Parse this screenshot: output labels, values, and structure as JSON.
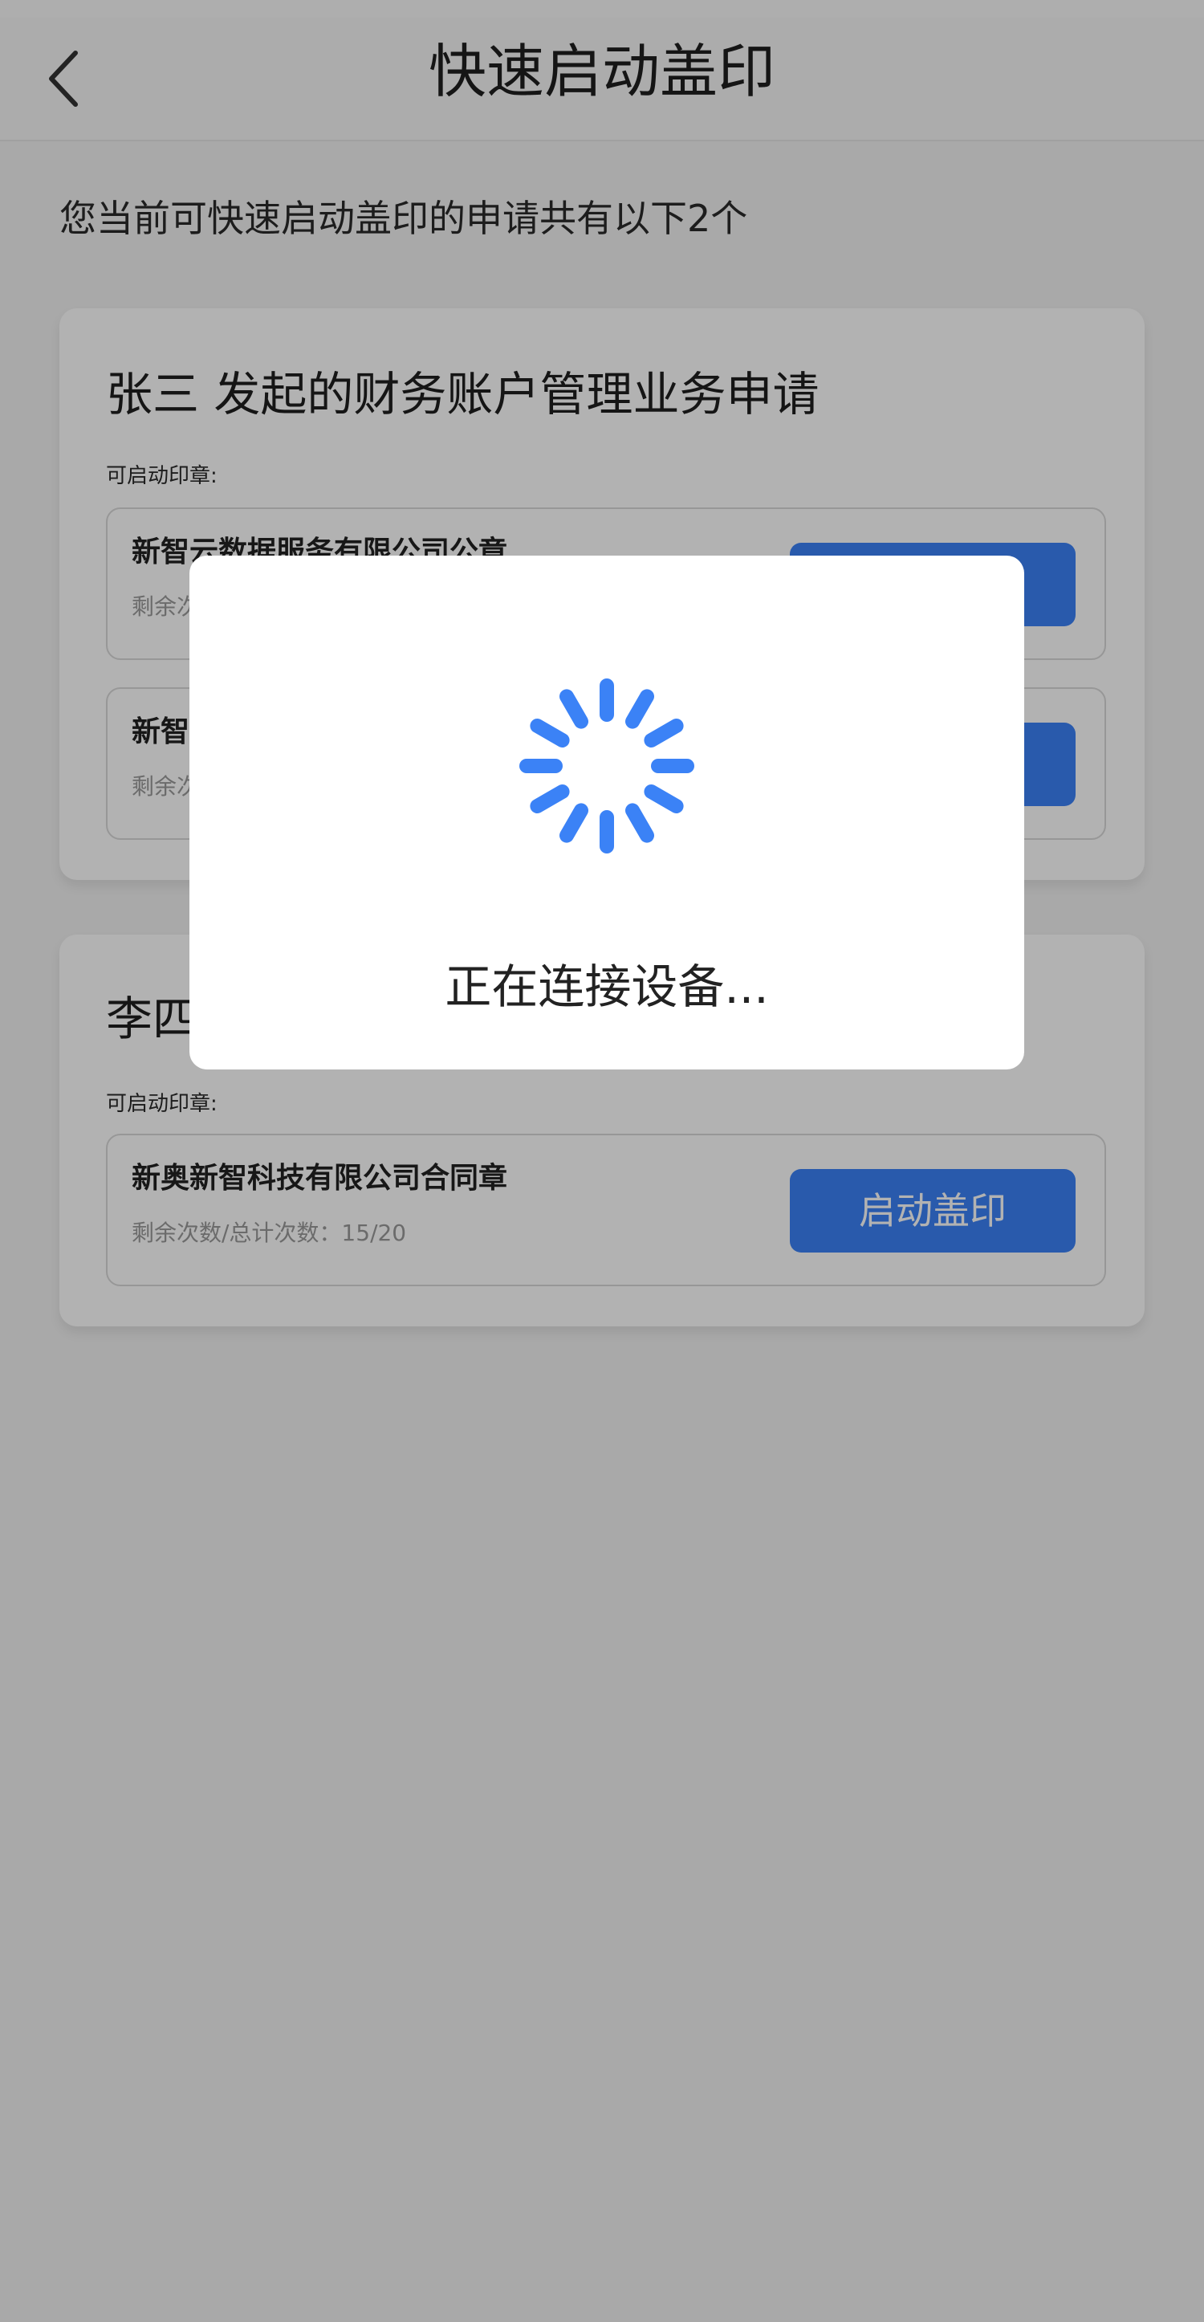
{
  "nav": {
    "title": "快速启动盖印",
    "back_icon": "chevron-left-icon"
  },
  "summary": "您当前可快速启动盖印的申请共有以下2个",
  "applications": [
    {
      "title": "张三 发起的财务账户管理业务申请",
      "seal_label": "可启动印章:",
      "seals": [
        {
          "name": "新智云数据服务有限公司公章",
          "count": "剩余次",
          "button": ""
        },
        {
          "name": "新智",
          "count": "剩余次",
          "button": ""
        }
      ]
    },
    {
      "title": "李四",
      "seal_label": "可启动印章:",
      "seals": [
        {
          "name": "新奥新智科技有限公司合同章",
          "count": "剩余次数/总计次数：15/20",
          "button": "启动盖印"
        }
      ]
    }
  ],
  "dialog": {
    "text": "正在连接设备...",
    "spinner_icon": "loading-spinner-icon"
  },
  "colors": {
    "accent": "#3b82f6",
    "overlay": "rgba(0,0,0,0.30)"
  }
}
